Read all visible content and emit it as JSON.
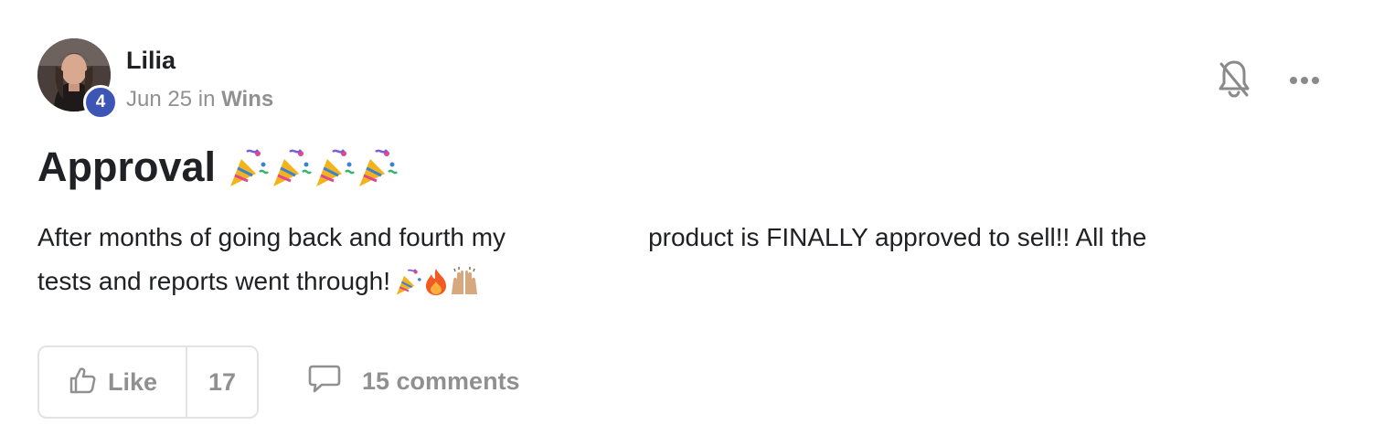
{
  "author": {
    "name": "Lilia",
    "level": "4",
    "date": "Jun 25",
    "in_word": "in",
    "category": "Wins"
  },
  "header_actions": {
    "notifications_icon": "bell-slash-icon",
    "more_icon": "more-horizontal-icon"
  },
  "post": {
    "title": "Approval",
    "title_emoji": "party-popper x4",
    "body_line1_a": "After months of going back and fourth my",
    "body_line1_b": "product is FINALLY approved to sell!! All the",
    "body_line2": "tests and reports went through!",
    "body_emoji": "party-popper, fire, raised-hands"
  },
  "footer": {
    "like_label": "Like",
    "like_count": "17",
    "comments_label": "15 comments"
  },
  "colors": {
    "badge": "#3d55b4",
    "muted_text": "#909090",
    "primary_text": "#202124",
    "border": "#e3e3e3"
  }
}
